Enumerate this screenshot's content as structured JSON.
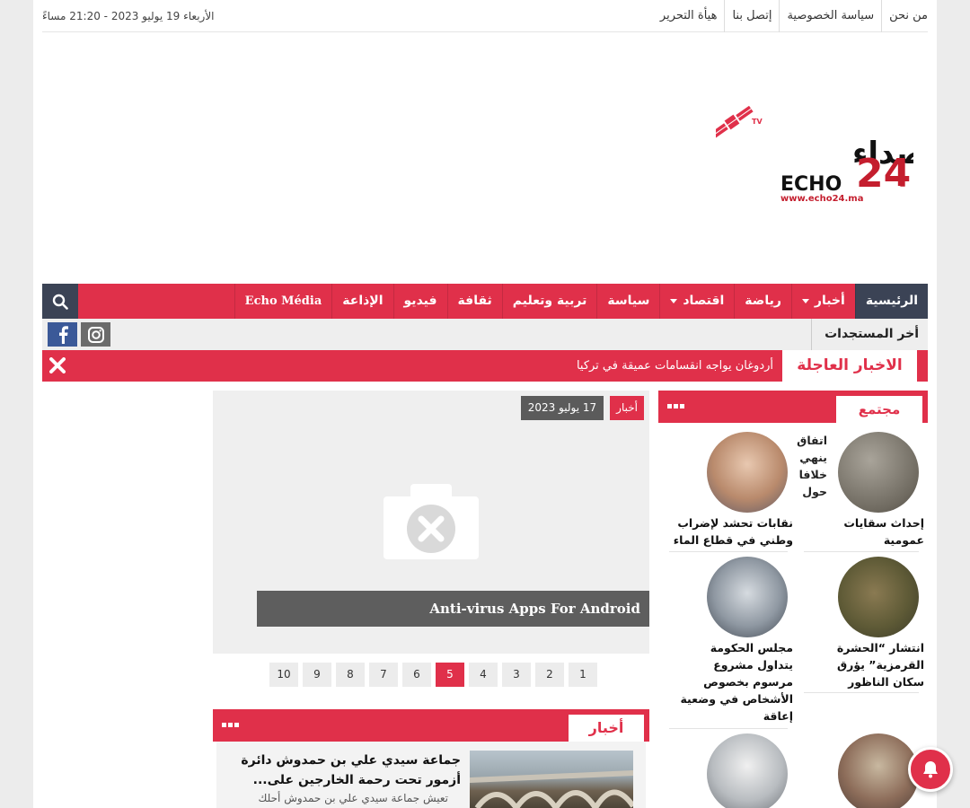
{
  "topbar": {
    "links": [
      "من نحن",
      "سياسة الخصوصية",
      "إتصل بنا",
      "هيأة التحرير"
    ],
    "date": "الأربعاء 19 يوليو 2023 - 21:20 مساءً"
  },
  "logo": {
    "arabic": "أصداء",
    "latin": "ECHO",
    "number": "24",
    "suffix": ".ma",
    "url": "www.echo24.ma",
    "tv": "TV"
  },
  "nav": {
    "items": [
      {
        "label": "الرئيسية",
        "active": true
      },
      {
        "label": "أخبار",
        "dropdown": true
      },
      {
        "label": "رياضة"
      },
      {
        "label": "اقتصاد",
        "dropdown": true
      },
      {
        "label": "سياسة"
      },
      {
        "label": "تربية وتعليم"
      },
      {
        "label": "ثقافة"
      },
      {
        "label": "فيديو"
      },
      {
        "label": "الإذاعة"
      },
      {
        "label": "Echo Média"
      }
    ],
    "search_icon": "search-icon"
  },
  "latest": {
    "label": "أخر المستجدات"
  },
  "breaking": {
    "label": "الاخبار العاجلة",
    "text": "أردوغان يواجه انقسامات عميقة في تركيا"
  },
  "slider": {
    "category": "أخبار",
    "date": "17 يوليو 2023",
    "title": "Anti-virus Apps For Android",
    "pages": [
      "1",
      "2",
      "3",
      "4",
      "5",
      "6",
      "7",
      "8",
      "9",
      "10"
    ],
    "current_page": "5"
  },
  "news_block": {
    "title": "أخبار",
    "article_title": "جماعة سيدي علي بن حمدوش دائرة أزمور تحت رحمة الخارجين على...",
    "article_excerpt": "تعيش جماعة سيدي علي بن حمدوش أحلك"
  },
  "sidebar": {
    "title": "مجتمع",
    "cards": [
      {
        "title": "إحداث سقايات عمومية",
        "caption": "اتفاق ينهي خلافا حول"
      },
      {
        "title": "نقابات تحشد لإضراب وطني في قطاع الماء"
      },
      {
        "title": "انتشار “الحشرة القرمزية” يؤرق سكان الناظور"
      },
      {
        "title": "مجلس الحكومة يتداول مشروع مرسوم بخصوص الأشخاص في وضعية إعاقة"
      }
    ]
  },
  "colors": {
    "accent": "#e0304a",
    "dark": "#3b4355"
  }
}
